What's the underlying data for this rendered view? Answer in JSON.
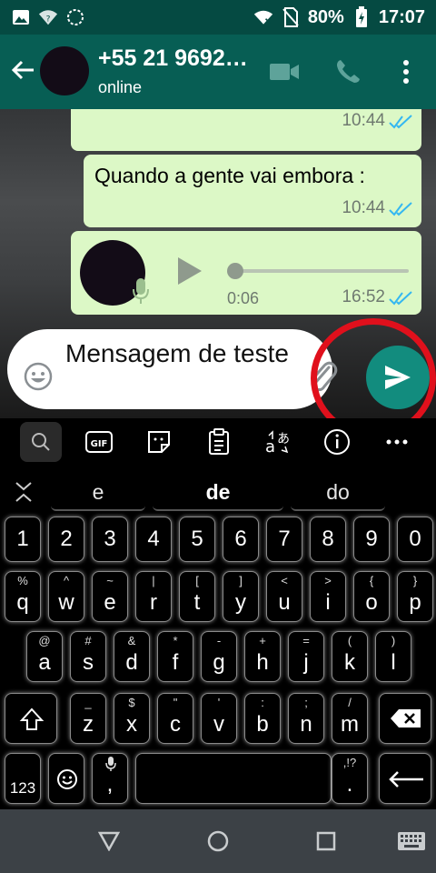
{
  "status_bar": {
    "battery": "80%",
    "time": "17:07",
    "icons": [
      "image-icon",
      "wifi-question-icon",
      "sync-icon",
      "wifi-off-icon",
      "sim-off-icon",
      "battery-charging-icon"
    ]
  },
  "header": {
    "contact_name": "+55 21 9692…",
    "status": "online",
    "icons": [
      "back-arrow-icon",
      "video-call-icon",
      "voice-call-icon",
      "more-vert-icon"
    ]
  },
  "messages": [
    {
      "text": "",
      "time": "10:44",
      "ticks": "double-check-blue"
    },
    {
      "text": "Quando a gente vai embora :",
      "time": "10:44",
      "ticks": "double-check-blue"
    },
    {
      "type": "voice",
      "duration": "0:06",
      "time": "16:52",
      "ticks": "double-check-blue",
      "progress": 0
    }
  ],
  "composer": {
    "value": "Mensagem de teste",
    "icons": [
      "emoji-icon",
      "attach-icon",
      "send-icon"
    ]
  },
  "keyboard": {
    "toolbar": [
      "search-icon",
      "gif-icon",
      "sticker-icon",
      "clipboard-icon",
      "translate-icon",
      "info-icon",
      "more-icon"
    ],
    "suggestions": [
      "e",
      "de",
      "do"
    ],
    "number_row": [
      "1",
      "2",
      "3",
      "4",
      "5",
      "6",
      "7",
      "8",
      "9",
      "0"
    ],
    "row1": [
      {
        "key": "q",
        "alt": "%"
      },
      {
        "key": "w",
        "alt": "^"
      },
      {
        "key": "e",
        "alt": "~"
      },
      {
        "key": "r",
        "alt": "|"
      },
      {
        "key": "t",
        "alt": "["
      },
      {
        "key": "y",
        "alt": "]"
      },
      {
        "key": "u",
        "alt": "<"
      },
      {
        "key": "i",
        "alt": ">"
      },
      {
        "key": "o",
        "alt": "{"
      },
      {
        "key": "p",
        "alt": "}"
      }
    ],
    "row2": [
      {
        "key": "a",
        "alt": "@"
      },
      {
        "key": "s",
        "alt": "#"
      },
      {
        "key": "d",
        "alt": "&"
      },
      {
        "key": "f",
        "alt": "*"
      },
      {
        "key": "g",
        "alt": "-"
      },
      {
        "key": "h",
        "alt": "+"
      },
      {
        "key": "j",
        "alt": "="
      },
      {
        "key": "k",
        "alt": "("
      },
      {
        "key": "l",
        "alt": ")"
      }
    ],
    "row3": [
      {
        "key": "z",
        "alt": "_"
      },
      {
        "key": "x",
        "alt": "$"
      },
      {
        "key": "c",
        "alt": "\""
      },
      {
        "key": "v",
        "alt": "'"
      },
      {
        "key": "b",
        "alt": ":"
      },
      {
        "key": "n",
        "alt": ";"
      },
      {
        "key": "m",
        "alt": "/"
      }
    ],
    "bottom": {
      "numbers_label": "123",
      "comma": ",",
      "period": ".",
      "period_alt": ",!?"
    }
  },
  "navigation": [
    "back-triangle-icon",
    "home-circle-icon",
    "recents-square-icon",
    "keyboard-icon"
  ],
  "colors": {
    "header": "#075e54",
    "status_bar": "#054a42",
    "bubble": "#dcf8c6",
    "send_button": "#128c7e",
    "highlight_ring": "#e0101c",
    "tick_blue": "#34b7f1"
  }
}
